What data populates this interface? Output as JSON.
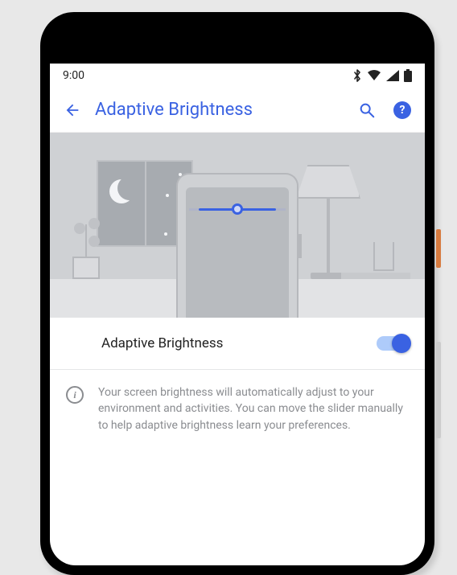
{
  "status": {
    "time": "9:00"
  },
  "appbar": {
    "title": "Adaptive Brightness"
  },
  "setting": {
    "label": "Adaptive Brightness",
    "enabled": true
  },
  "description": {
    "text": "Your screen brightness will automatically adjust to your environment and activities. You can move the slider manually to help adaptive brightness learn your preferences."
  }
}
